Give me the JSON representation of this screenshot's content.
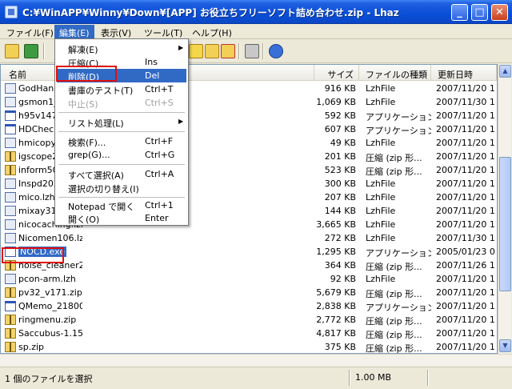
{
  "window": {
    "title": "C:¥WinAPP¥Winny¥Down¥[APP] お役立ちフリーソフト詰め合わせ.zip - Lhaz",
    "minimize": "_",
    "maximize": "□",
    "close": "✕"
  },
  "menubar": [
    {
      "label": "ファイル(F)"
    },
    {
      "label": "編集(E)"
    },
    {
      "label": "表示(V)"
    },
    {
      "label": "ツール(T)"
    },
    {
      "label": "ヘルプ(H)"
    }
  ],
  "columns": {
    "name": "名前",
    "size": "サイズ",
    "type": "ファイルの種類",
    "date": "更新日時"
  },
  "files": [
    {
      "name": "GodHand",
      "size": "916 KB",
      "type": "LzhFile",
      "date": "2007/11/20 1",
      "icon": "lzh"
    },
    {
      "name": "gsmon1_",
      "size": "1,069 KB",
      "type": "LzhFile",
      "date": "2007/11/30 1",
      "icon": "lzh"
    },
    {
      "name": "h95v147",
      "size": "592 KB",
      "type": "アプリケーション",
      "date": "2007/11/20 1",
      "icon": "exe"
    },
    {
      "name": "HDCheck",
      "size": "607 KB",
      "type": "アプリケーション",
      "date": "2007/11/20 1",
      "icon": "exe"
    },
    {
      "name": "hmicopy.",
      "size": "49 KB",
      "type": "LzhFile",
      "date": "2007/11/20 1",
      "icon": "lzh"
    },
    {
      "name": "igscope2",
      "size": "201 KB",
      "type": "圧縮 (zip 形...",
      "date": "2007/11/20 1",
      "icon": "zip"
    },
    {
      "name": "inform50",
      "size": "523 KB",
      "type": "圧縮 (zip 形...",
      "date": "2007/11/20 1",
      "icon": "zip"
    },
    {
      "name": "Inspd202",
      "size": "300 KB",
      "type": "LzhFile",
      "date": "2007/11/20 1",
      "icon": "lzh"
    },
    {
      "name": "mico.lzh",
      "size": "207 KB",
      "type": "LzhFile",
      "date": "2007/11/20 1",
      "icon": "lzh"
    },
    {
      "name": "mixay310",
      "size": "144 KB",
      "type": "LzhFile",
      "date": "2007/11/20 1",
      "icon": "lzh"
    },
    {
      "name": "nicocaching.lzh",
      "size": "3,665 KB",
      "type": "LzhFile",
      "date": "2007/11/20 1",
      "icon": "lzh"
    },
    {
      "name": "Nicomen106.lzh",
      "size": "272 KB",
      "type": "LzhFile",
      "date": "2007/11/30 1",
      "icon": "lzh"
    },
    {
      "name": "NOCD.exe",
      "size": "1,295 KB",
      "type": "アプリケーション",
      "date": "2005/01/23 0",
      "icon": "exe",
      "selected": true
    },
    {
      "name": "noise_cleaner2.zip",
      "size": "364 KB",
      "type": "圧縮 (zip 形...",
      "date": "2007/11/26 1",
      "icon": "zip"
    },
    {
      "name": "pcon-arm.lzh",
      "size": "92 KB",
      "type": "LzhFile",
      "date": "2007/11/20 1",
      "icon": "lzh"
    },
    {
      "name": "pv32_v171.zip",
      "size": "5,679 KB",
      "type": "圧縮 (zip 形...",
      "date": "2007/11/20 1",
      "icon": "zip"
    },
    {
      "name": "QMemo_21800.EXE",
      "size": "2,838 KB",
      "type": "アプリケーション",
      "date": "2007/11/20 1",
      "icon": "exe"
    },
    {
      "name": "ringmenu.zip",
      "size": "2,772 KB",
      "type": "圧縮 (zip 形...",
      "date": "2007/11/20 1",
      "icon": "zip"
    },
    {
      "name": "Saccubus-1.15r.zip",
      "size": "4,817 KB",
      "type": "圧縮 (zip 形...",
      "date": "2007/11/20 1",
      "icon": "zip"
    },
    {
      "name": "sp.zip",
      "size": "375 KB",
      "type": "圧縮 (zip 形...",
      "date": "2007/11/20 1",
      "icon": "zip"
    }
  ],
  "edit_menu": {
    "items": [
      {
        "label": "解凍(E)",
        "shortcut": "",
        "submenu": true
      },
      {
        "label": "圧縮(C)...",
        "shortcut": "Ins"
      },
      {
        "label": "削除(D)",
        "shortcut": "Del",
        "selected": true
      },
      {
        "label": "書庫のテスト(T)",
        "shortcut": "Ctrl+T"
      },
      {
        "label": "中止(S)",
        "shortcut": "Ctrl+S",
        "disabled": true
      },
      {
        "label": "リスト処理(L)",
        "shortcut": "",
        "submenu": true
      },
      {
        "label": "検索(F)...",
        "shortcut": "Ctrl+F"
      },
      {
        "label": "grep(G)...",
        "shortcut": "Ctrl+G"
      },
      {
        "label": "すべて選択(A)",
        "shortcut": "Ctrl+A"
      },
      {
        "label": "選択の切り替え(I)",
        "shortcut": ""
      },
      {
        "label": "Notepad で開く",
        "shortcut": "Ctrl+1"
      },
      {
        "label": "開く(O)",
        "shortcut": "Enter"
      }
    ]
  },
  "status": {
    "selection": "1 個のファイルを選択",
    "size": "1.00 MB"
  },
  "colors": {
    "selection": "#316ac5",
    "highlight_box": "#e01010"
  }
}
